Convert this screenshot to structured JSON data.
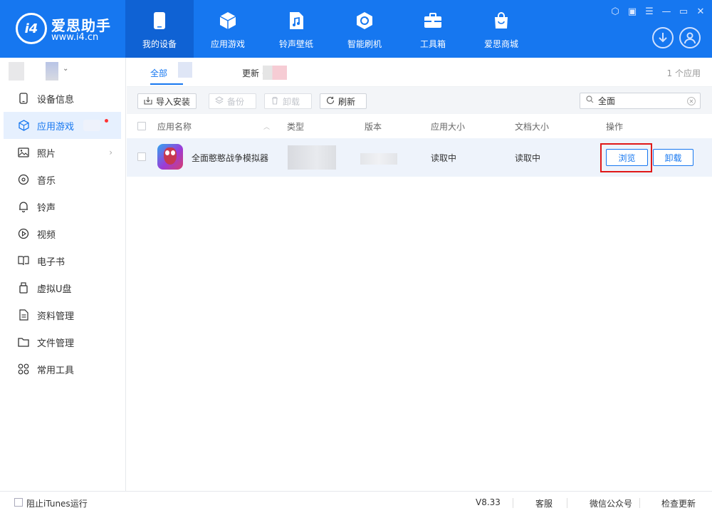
{
  "header": {
    "logo_text": "i4",
    "brand_name": "爱思助手",
    "brand_url": "www.i4.cn",
    "nav": [
      {
        "label": "我的设备",
        "icon": "phone-icon"
      },
      {
        "label": "应用游戏",
        "icon": "cube-icon"
      },
      {
        "label": "铃声壁纸",
        "icon": "music-file-icon"
      },
      {
        "label": "智能刷机",
        "icon": "refresh-shield-icon"
      },
      {
        "label": "工具箱",
        "icon": "toolbox-icon"
      },
      {
        "label": "爱思商城",
        "icon": "shopping-bag-icon"
      }
    ],
    "active_nav": 0,
    "window_controls": [
      "skin",
      "feedback",
      "menu",
      "minimize",
      "maximize",
      "close"
    ]
  },
  "sidebar": {
    "items": [
      {
        "label": "设备信息",
        "icon": "phone-outline-icon"
      },
      {
        "label": "应用游戏",
        "icon": "cube-outline-icon",
        "active": true
      },
      {
        "label": "照片",
        "icon": "image-icon",
        "has_arrow": true
      },
      {
        "label": "音乐",
        "icon": "music-disc-icon"
      },
      {
        "label": "铃声",
        "icon": "bell-icon"
      },
      {
        "label": "视频",
        "icon": "play-circle-icon"
      },
      {
        "label": "电子书",
        "icon": "book-icon"
      },
      {
        "label": "虚拟U盘",
        "icon": "usb-drive-icon"
      },
      {
        "label": "资料管理",
        "icon": "document-icon"
      },
      {
        "label": "文件管理",
        "icon": "folder-icon"
      },
      {
        "label": "常用工具",
        "icon": "grid-icon"
      }
    ]
  },
  "tabs": {
    "all": "全部",
    "update": "更新 (",
    "count": "1 个应用"
  },
  "toolbar": {
    "import": "导入安装",
    "backup": "备份",
    "uninstall": "卸载",
    "refresh": "刷新",
    "search_value": "全面"
  },
  "table": {
    "headers": [
      "应用名称",
      "类型",
      "版本",
      "应用大小",
      "文档大小",
      "操作"
    ],
    "rows": [
      {
        "name": "全面憨憨战争模拟器",
        "app_size": "读取中",
        "doc_size": "读取中",
        "actions": [
          "浏览",
          "卸载"
        ]
      }
    ]
  },
  "footer": {
    "block_itunes": "阻止iTunes运行",
    "version": "V8.33",
    "service": "客服",
    "wechat": "微信公众号",
    "check_update": "检查更新"
  },
  "colors": {
    "brand_blue": "#1677f0",
    "active_nav": "#0f62d4",
    "highlight_red": "#e01818",
    "notification_dot": "#ff3333"
  }
}
